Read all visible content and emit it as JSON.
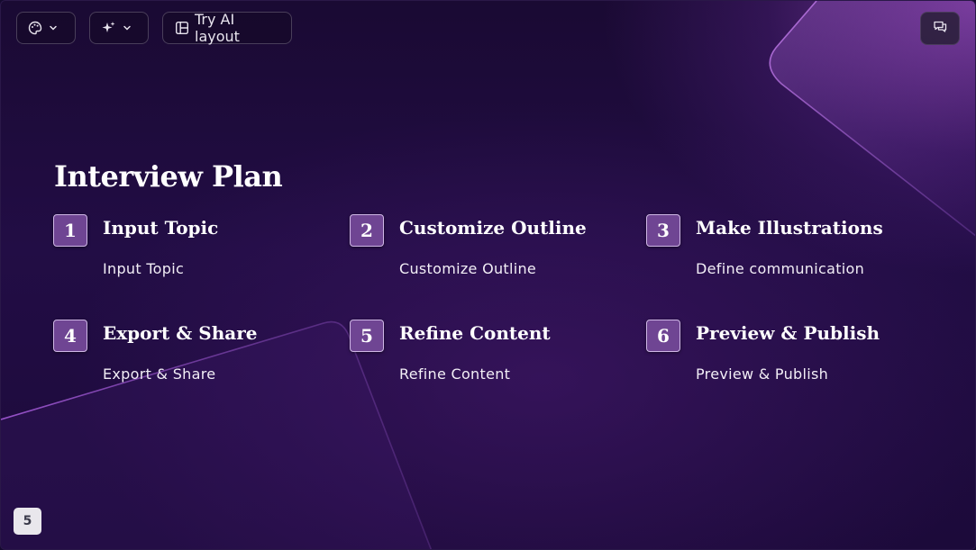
{
  "toolbar": {
    "theme_icon": "palette-icon",
    "ai_icon": "sparkles-icon",
    "layout_icon": "layout-icon",
    "layout_label": "Try AI layout",
    "comments_icon": "comments-icon"
  },
  "slide": {
    "title": "Interview Plan",
    "steps": [
      {
        "number": "1",
        "title": "Input Topic",
        "desc": "Input Topic"
      },
      {
        "number": "2",
        "title": "Customize Outline",
        "desc": "Customize Outline"
      },
      {
        "number": "3",
        "title": "Make Illustrations",
        "desc": "Define communication"
      },
      {
        "number": "4",
        "title": "Export & Share",
        "desc": "Export & Share"
      },
      {
        "number": "5",
        "title": "Refine Content",
        "desc": "Refine Content"
      },
      {
        "number": "6",
        "title": "Preview & Publish",
        "desc": "Preview & Publish"
      }
    ],
    "page_number": "5"
  },
  "colors": {
    "background": "#1a0a33",
    "accent": "#6f4593",
    "glow": "#be5fe6"
  }
}
